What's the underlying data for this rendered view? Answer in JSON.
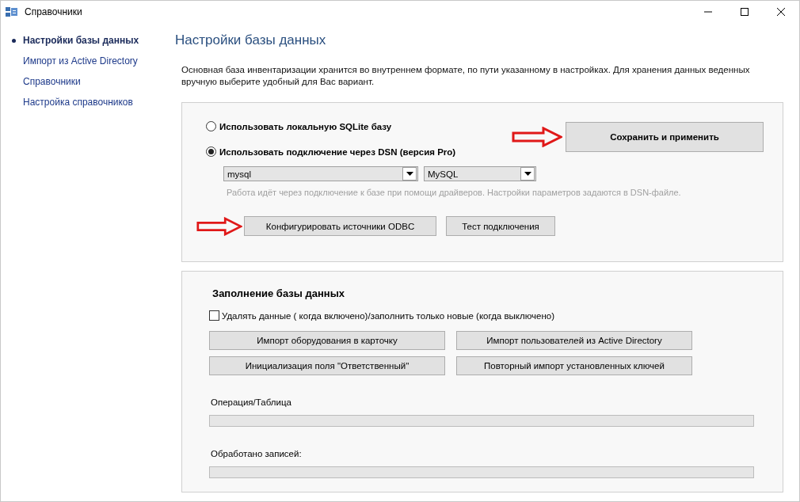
{
  "window": {
    "title": "Справочники"
  },
  "sidebar": {
    "items": [
      {
        "label": "Настройки базы данных",
        "selected": true
      },
      {
        "label": "Импорт из Active Directory",
        "selected": false
      },
      {
        "label": "Справочники",
        "selected": false
      },
      {
        "label": "Настройка справочников",
        "selected": false
      }
    ]
  },
  "page": {
    "title": "Настройки базы данных",
    "description": "Основная база инвентаризации хранится во внутреннем формате, по пути указанному в настройках. Для хранения данных веденных вручную выберите удобный для Вас вариант."
  },
  "connection": {
    "options": [
      {
        "label": "Использовать локальную SQLite базу",
        "selected": false
      },
      {
        "label": "Использовать подключение через DSN (версия Pro)",
        "selected": true
      }
    ],
    "dsn": {
      "value": "mysql"
    },
    "driver": {
      "value": "MySQL"
    },
    "hint": "Работа идёт через подключение к базе при помощи драйверов. Настройки параметров задаются в DSN-файле.",
    "save_button": "Сохранить и применить",
    "odbc_button": "Конфигурировать источники ODBC",
    "test_button": "Тест подключения"
  },
  "fill": {
    "title": "Заполнение базы данных",
    "delete_checkbox": {
      "label": "Удалять данные ( когда включено)/заполнить только новые (когда выключено)",
      "checked": false
    },
    "buttons": [
      "Импорт оборудования в карточку",
      "Импорт пользователей из Active Directory",
      "Инициализация поля \"Ответственный\"",
      "Повторный импорт установленных ключей"
    ],
    "progress": [
      {
        "label": "Операция/Таблица",
        "level": 0
      },
      {
        "label": "Обработано записей:",
        "level": 0
      }
    ]
  }
}
